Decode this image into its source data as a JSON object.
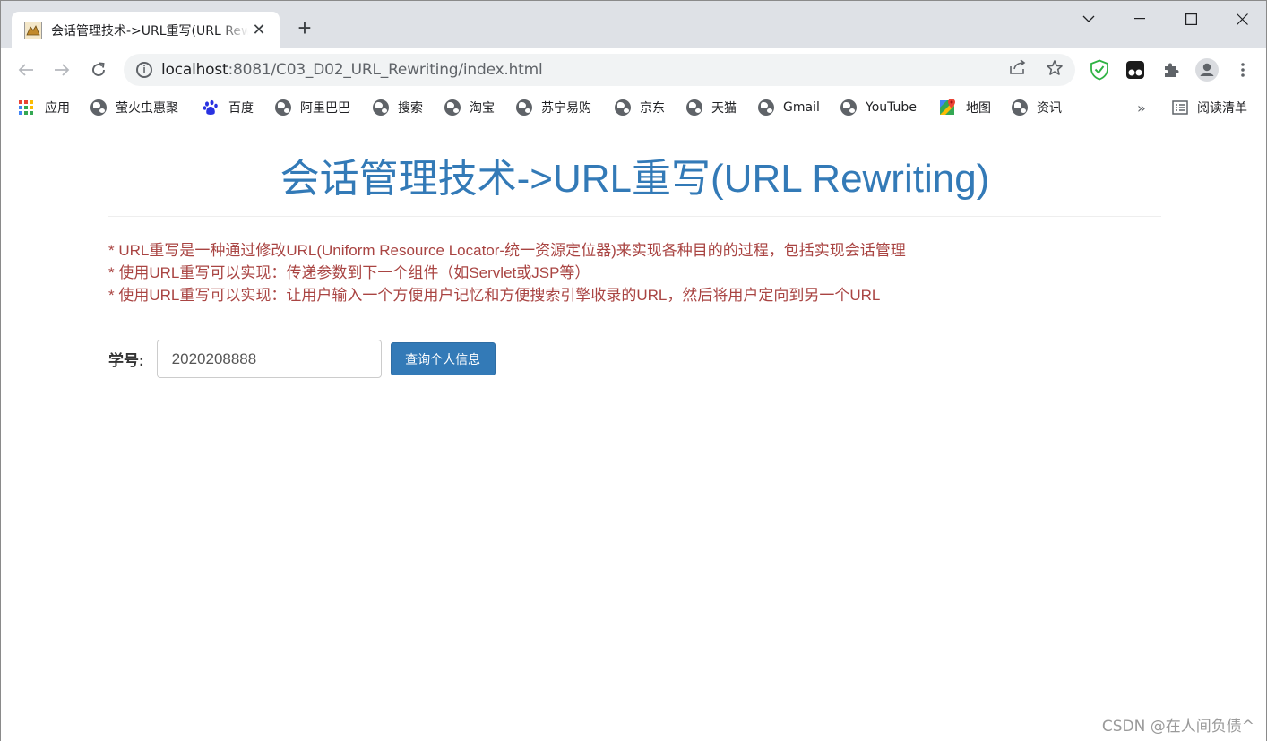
{
  "tab": {
    "title": "会话管理技术->URL重写(URL Rewriting)",
    "close_glyph": "✕",
    "new_tab_glyph": "+"
  },
  "window_controls": {
    "list_glyph": "⌵",
    "minimize_glyph": "─",
    "maximize_glyph": "☐",
    "close_glyph": "✕"
  },
  "toolbar": {
    "back_glyph": "←",
    "forward_glyph": "→",
    "reload_glyph": "↻",
    "url_host": "localhost",
    "url_rest": ":8081/C03_D02_URL_Rewriting/index.html",
    "share_glyph": "⇪",
    "star_glyph": "☆",
    "puzzle_glyph": "✚",
    "menu_glyph": "⋮"
  },
  "bookmarks": {
    "items": [
      {
        "label": "应用",
        "icon": "apps-grid-icon"
      },
      {
        "label": "萤火虫惠聚",
        "icon": "globe-icon"
      },
      {
        "label": "百度",
        "icon": "baidu-paw-icon"
      },
      {
        "label": "阿里巴巴",
        "icon": "globe-icon"
      },
      {
        "label": "搜索",
        "icon": "globe-icon"
      },
      {
        "label": "淘宝",
        "icon": "globe-icon"
      },
      {
        "label": "苏宁易购",
        "icon": "globe-icon"
      },
      {
        "label": "京东",
        "icon": "globe-icon"
      },
      {
        "label": "天猫",
        "icon": "globe-icon"
      },
      {
        "label": "Gmail",
        "icon": "globe-icon"
      },
      {
        "label": "YouTube",
        "icon": "globe-icon"
      },
      {
        "label": "地图",
        "icon": "maps-icon"
      },
      {
        "label": "资讯",
        "icon": "globe-icon"
      }
    ],
    "overflow_glyph": "»",
    "reading_list_label": "阅读清单"
  },
  "page": {
    "title": "会话管理技术->URL重写(URL Rewriting)",
    "notes": [
      "* URL重写是一种通过修改URL(Uniform Resource Locator-统一资源定位器)来实现各种目的的过程，包括实现会话管理",
      "* 使用URL重写可以实现：传递参数到下一个组件（如Servlet或JSP等）",
      "* 使用URL重写可以实现：让用户输入一个方便用户记忆和方便搜索引擎收录的URL，然后将用户定向到另一个URL"
    ],
    "form": {
      "label": "学号:",
      "input_value": "2020208888",
      "button_label": "查询个人信息"
    },
    "watermark": "CSDN @在人间负债^"
  },
  "colors": {
    "title_blue": "#337ab7",
    "note_red": "#a94442",
    "button_blue": "#337ab7",
    "tabstrip_gray": "#dee1e6"
  }
}
